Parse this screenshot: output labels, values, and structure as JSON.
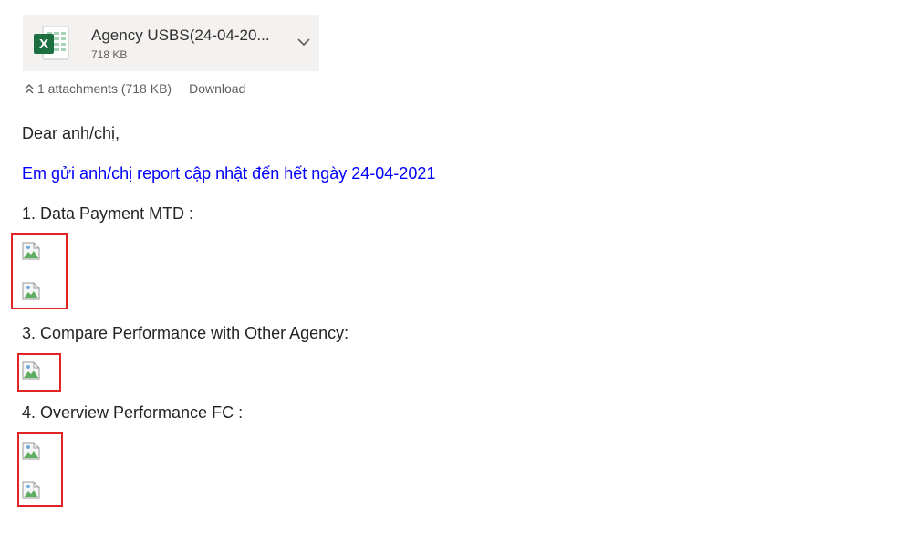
{
  "attachment": {
    "file_name": "Agency USBS(24-04-20...",
    "file_size": "718 KB",
    "icon": "excel-file-icon",
    "summary": "1 attachments (718 KB)",
    "download_label": "Download"
  },
  "message": {
    "greeting": "Dear anh/chị,",
    "intro": "Em gửi anh/chị report cập nhật đến hết ngày 24-04-2021",
    "intro_color": "#0000ff",
    "sections": [
      {
        "title": "1. Data Payment MTD :",
        "broken_images": 2
      },
      {
        "title": "3. Compare Performance with Other Agency:",
        "broken_images": 1
      },
      {
        "title": "4. Overview Performance FC :",
        "broken_images": 2
      }
    ],
    "highlight_color": "#e02424"
  }
}
